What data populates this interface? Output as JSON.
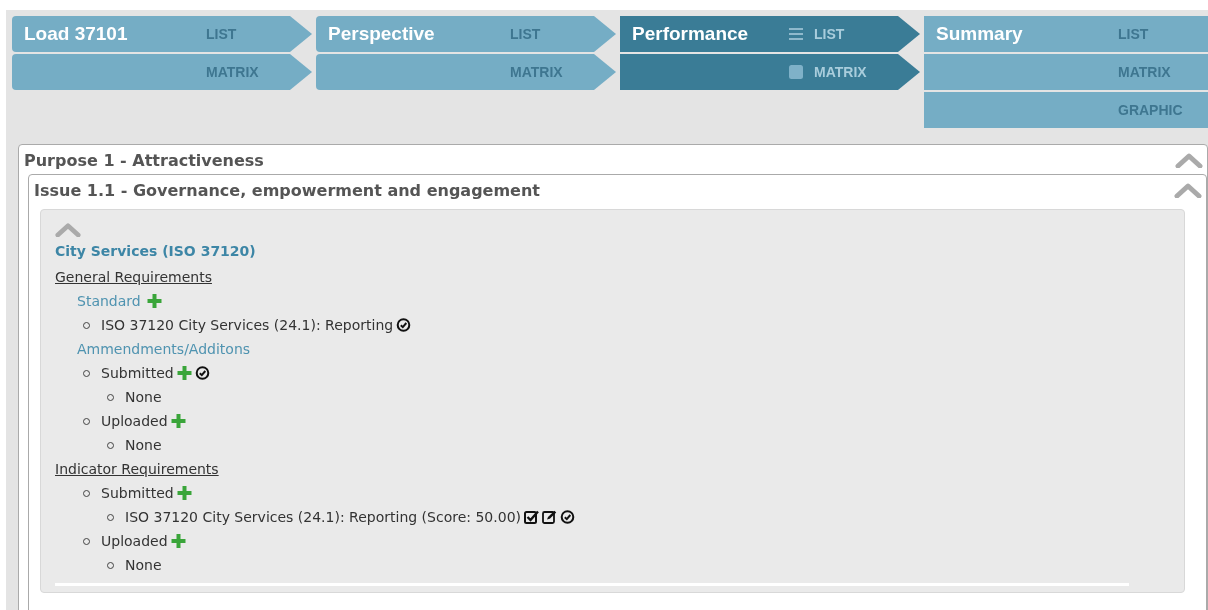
{
  "steps": [
    {
      "title": "Load 37101",
      "selected": false,
      "options": [
        "LIST",
        "MATRIX"
      ]
    },
    {
      "title": "Perspective",
      "selected": false,
      "options": [
        "LIST",
        "MATRIX"
      ]
    },
    {
      "title": "Performance",
      "selected": true,
      "options": [
        "LIST",
        "MATRIX"
      ]
    },
    {
      "title": "Summary",
      "selected": false,
      "options": [
        "LIST",
        "MATRIX",
        "GRAPHIC"
      ]
    }
  ],
  "purpose": {
    "title": "Purpose 1 - Attractiveness",
    "expanded": true,
    "issue": {
      "title": "Issue 1.1 - Governance, empowerment and engagement",
      "expanded": true,
      "section": {
        "title": "City Services (ISO 37120)",
        "expanded": true,
        "items": [
          {
            "kind": "heading",
            "label": "General Requirements",
            "children": [
              {
                "kind": "subhead",
                "label": "Standard",
                "add": true,
                "children": [
                  {
                    "kind": "bullet",
                    "label": "ISO 37120 City Services (24.1): Reporting",
                    "approved": true
                  }
                ]
              },
              {
                "kind": "subhead",
                "label": "Ammendments/Additons",
                "children": [
                  {
                    "kind": "bullet",
                    "label": "Submitted",
                    "add": true,
                    "approved": true,
                    "children": [
                      {
                        "kind": "bullet",
                        "label": "None"
                      }
                    ]
                  },
                  {
                    "kind": "bullet",
                    "label": "Uploaded",
                    "add": true,
                    "children": [
                      {
                        "kind": "bullet",
                        "label": "None"
                      }
                    ]
                  }
                ]
              }
            ]
          },
          {
            "kind": "heading",
            "label": "Indicator Requirements",
            "children": [
              {
                "kind": "bullet",
                "label": "Submitted",
                "add": true,
                "children": [
                  {
                    "kind": "bullet",
                    "label": "ISO 37120 City Services (24.1): Reporting (Score: 50.00)",
                    "checked": true,
                    "editable": true,
                    "approved": true
                  }
                ]
              },
              {
                "kind": "bullet",
                "label": "Uploaded",
                "add": true,
                "children": [
                  {
                    "kind": "bullet",
                    "label": "None"
                  }
                ]
              }
            ]
          }
        ]
      }
    }
  }
}
